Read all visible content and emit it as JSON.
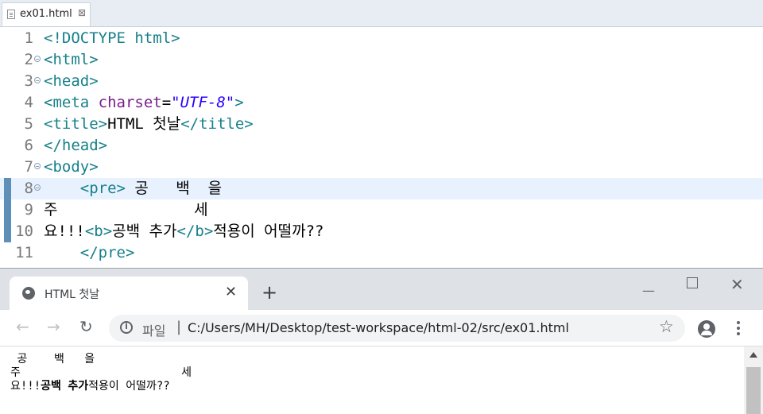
{
  "editor": {
    "tab": {
      "filename": "ex01.html",
      "close": "⊠"
    },
    "lines": [
      {
        "num": "1",
        "tokens": [
          {
            "c": "t",
            "x": "<!DOCTYPE html>"
          }
        ]
      },
      {
        "num": "2",
        "tokens": [
          {
            "c": "t",
            "x": "<html>"
          }
        ]
      },
      {
        "num": "3",
        "tokens": [
          {
            "c": "t",
            "x": "<head>"
          }
        ]
      },
      {
        "num": "4",
        "tokens": [
          {
            "c": "t",
            "x": "<meta "
          },
          {
            "c": "a",
            "x": "charset"
          },
          {
            "c": "",
            "x": "="
          },
          {
            "c": "s",
            "x": "\"UTF-8\""
          },
          {
            "c": "t",
            "x": ">"
          }
        ]
      },
      {
        "num": "5",
        "tokens": [
          {
            "c": "t",
            "x": "<title>"
          },
          {
            "c": "",
            "x": "HTML 첫날"
          },
          {
            "c": "t",
            "x": "</title>"
          }
        ]
      },
      {
        "num": "6",
        "tokens": [
          {
            "c": "t",
            "x": "</head>"
          }
        ]
      },
      {
        "num": "7",
        "tokens": [
          {
            "c": "t",
            "x": "<body>"
          }
        ]
      },
      {
        "num": "8",
        "tokens": [
          {
            "c": "",
            "x": "    "
          },
          {
            "c": "t",
            "x": "<pre>"
          },
          {
            "c": "",
            "x": " 공   백  을"
          }
        ]
      },
      {
        "num": "9",
        "tokens": [
          {
            "c": "",
            "x": "주               세"
          }
        ]
      },
      {
        "num": "10",
        "tokens": [
          {
            "c": "",
            "x": "요!!!"
          },
          {
            "c": "t",
            "x": "<b>"
          },
          {
            "c": "",
            "x": "공백 추가"
          },
          {
            "c": "t",
            "x": "</b>"
          },
          {
            "c": "",
            "x": "적용이 어떨까??"
          }
        ]
      },
      {
        "num": "11",
        "tokens": [
          {
            "c": "",
            "x": "    "
          },
          {
            "c": "t",
            "x": "</pre>"
          }
        ]
      }
    ]
  },
  "browser": {
    "tab_title": "HTML 첫날",
    "tab_close": "✕",
    "new_tab": "+",
    "window": {
      "minimize": "—",
      "close": "✕"
    },
    "nav": {
      "back": "←",
      "forward": "→",
      "reload": "↻"
    },
    "omnibox": {
      "label": "파일",
      "separator": "|",
      "url": "C:/Users/MH/Desktop/test-workspace/html-02/src/ex01.html"
    },
    "star": "☆",
    "page": {
      "pre_line1": " 공    백   을",
      "pre_line2": "주                        세",
      "pre_line3_prefix": "요!!!",
      "pre_line3_bold": "공백 추가",
      "pre_line3_suffix": "적용이 어떨까??"
    }
  }
}
